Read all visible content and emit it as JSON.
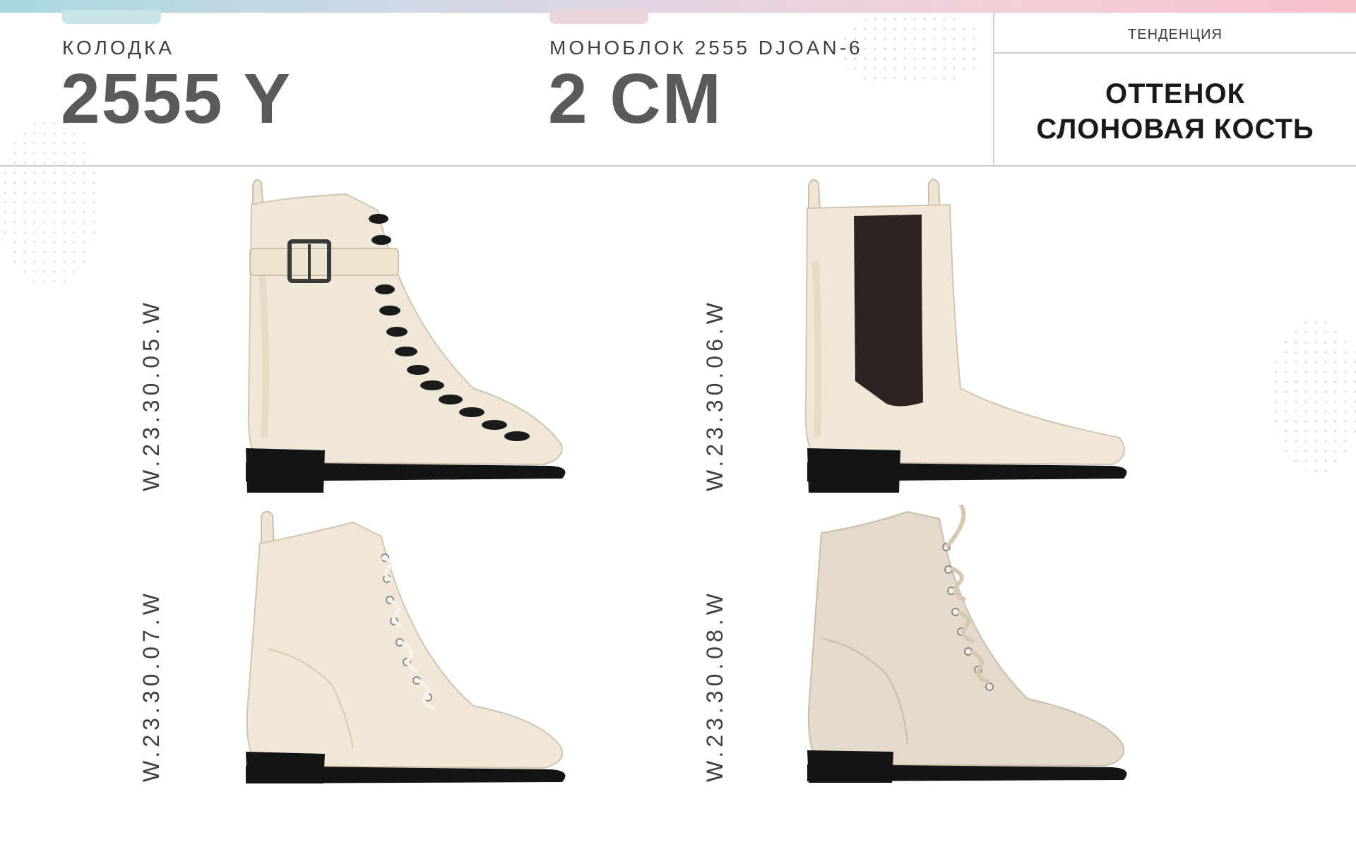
{
  "header": {
    "last_label": "КОЛОДКА",
    "last_value": "2555 Y",
    "monoblock_label": "МОНОБЛОК 2555 DJOAN-6",
    "monoblock_value": "2 CM",
    "trend_label": "ТЕНДЕНЦИЯ",
    "trend_value_line1": "ОТТЕНОК",
    "trend_value_line2": "СЛОНОВАЯ КОСТЬ"
  },
  "products": [
    {
      "code": "W.23.30.05.W",
      "style": "buckle-lace-boot"
    },
    {
      "code": "W.23.30.06.W",
      "style": "chelsea-boot"
    },
    {
      "code": "W.23.30.07.W",
      "style": "lace-up-boot"
    },
    {
      "code": "W.23.30.08.W",
      "style": "suede-lace-up-boot"
    }
  ],
  "colors": {
    "ivory": "#f0e7d7",
    "ivory_shadow": "#d9cdb9",
    "suede": "#e4dacb",
    "sole": "#141414",
    "elastic": "#2b2420"
  }
}
